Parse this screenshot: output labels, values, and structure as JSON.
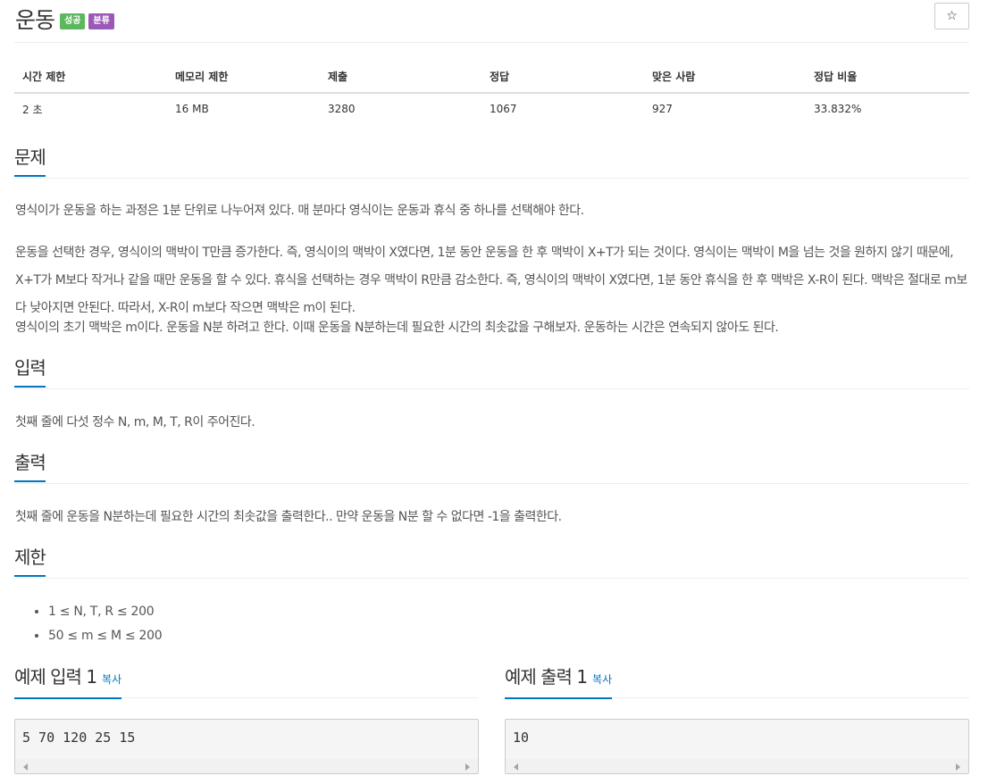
{
  "problem": {
    "title": "운동",
    "badges": {
      "success": "성공",
      "category": "분류"
    },
    "star_icon": "star-icon"
  },
  "info_table": {
    "headers": [
      "시간 제한",
      "메모리 제한",
      "제출",
      "정답",
      "맞은 사람",
      "정답 비율"
    ],
    "values": [
      "2 초",
      "16 MB",
      "3280",
      "1067",
      "927",
      "33.832%"
    ]
  },
  "sections": {
    "description": {
      "heading": "문제",
      "paragraphs": [
        "영식이가 운동을 하는 과정은 1분 단위로 나누어져 있다. 매 분마다 영식이는 운동과 휴식 중 하나를 선택해야 한다.",
        "운동을 선택한 경우, 영식이의 맥박이 T만큼 증가한다. 즉, 영식이의 맥박이 X였다면, 1분 동안 운동을 한 후 맥박이 X+T가 되는 것이다. 영식이는 맥박이 M을 넘는 것을 원하지 않기 때문에, X+T가 M보다 작거나 같을 때만 운동을 할 수 있다. 휴식을 선택하는 경우 맥박이 R만큼 감소한다. 즉, 영식이의 맥박이 X였다면, 1분 동안 휴식을 한 후 맥박은 X-R이 된다. 맥박은 절대로 m보다 낮아지면 안된다. 따라서, X-R이 m보다 작으면 맥박은 m이 된다.",
        "영식이의 초기 맥박은 m이다. 운동을 N분 하려고 한다. 이때 운동을 N분하는데 필요한 시간의 최솟값을 구해보자. 운동하는 시간은 연속되지 않아도 된다."
      ]
    },
    "input": {
      "heading": "입력",
      "text": "첫째 줄에 다섯 정수 N, m, M, T, R이 주어진다."
    },
    "output": {
      "heading": "출력",
      "text": "첫째 줄에 운동을 N분하는데 필요한 시간의 최솟값을 출력한다.. 만약 운동을 N분 할 수 없다면 -1을 출력한다."
    },
    "limits": {
      "heading": "제한",
      "items": [
        "1 ≤ N, T, R ≤ 200",
        "50 ≤ m ≤ M ≤ 200"
      ]
    },
    "sample_input": {
      "heading": "예제 입력 1",
      "copy_label": "복사",
      "content": "5 70 120 25 15"
    },
    "sample_output": {
      "heading": "예제 출력 1",
      "copy_label": "복사",
      "content": "10"
    }
  },
  "colors": {
    "accent": "#0076c0",
    "success_badge": "#5cb85c",
    "category_badge": "#9b59b6"
  }
}
